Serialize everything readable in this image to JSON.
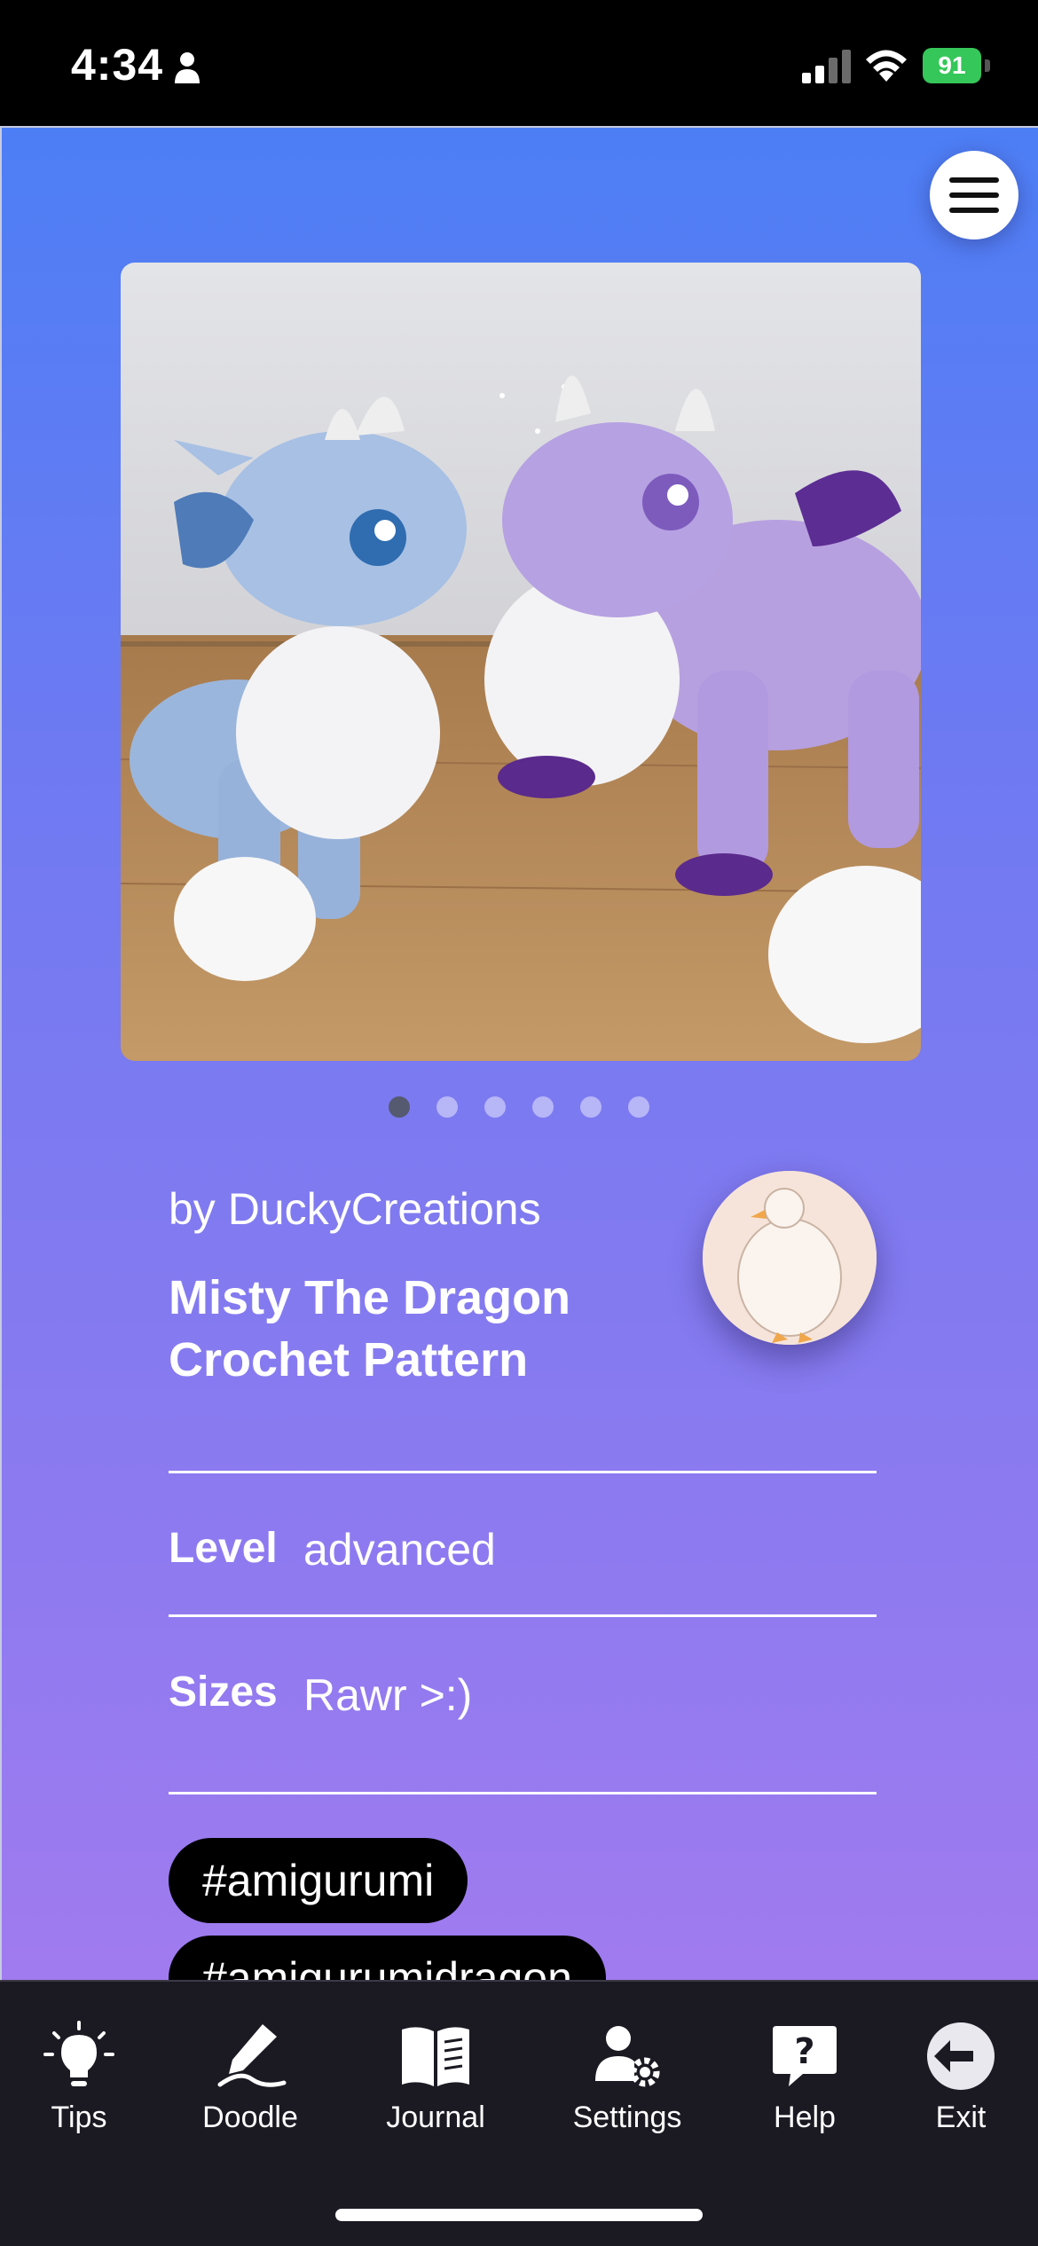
{
  "status_bar": {
    "time": "4:34",
    "battery": "91"
  },
  "pattern": {
    "author": "by DuckyCreations",
    "title": "Misty The Dragon Crochet Pattern",
    "level_label": "Level",
    "level_value": "advanced",
    "sizes_label": "Sizes",
    "sizes_value": "Rawr >:)",
    "carousel": {
      "total": 6,
      "active": 1
    },
    "tags": [
      "#amigurumi",
      "#amigurumidragon"
    ]
  },
  "nav": {
    "items": [
      {
        "label": "Tips",
        "icon": "lightbulb-icon"
      },
      {
        "label": "Doodle",
        "icon": "pen-icon"
      },
      {
        "label": "Journal",
        "icon": "book-icon"
      },
      {
        "label": "Settings",
        "icon": "user-gear-icon"
      },
      {
        "label": "Help",
        "icon": "help-icon"
      },
      {
        "label": "Exit",
        "icon": "exit-icon"
      }
    ]
  },
  "colors": {
    "gradient_top": "#4d7ef5",
    "gradient_bottom": "#a07bef",
    "nav_background": "#1b1a23",
    "tag_background": "#000000"
  }
}
